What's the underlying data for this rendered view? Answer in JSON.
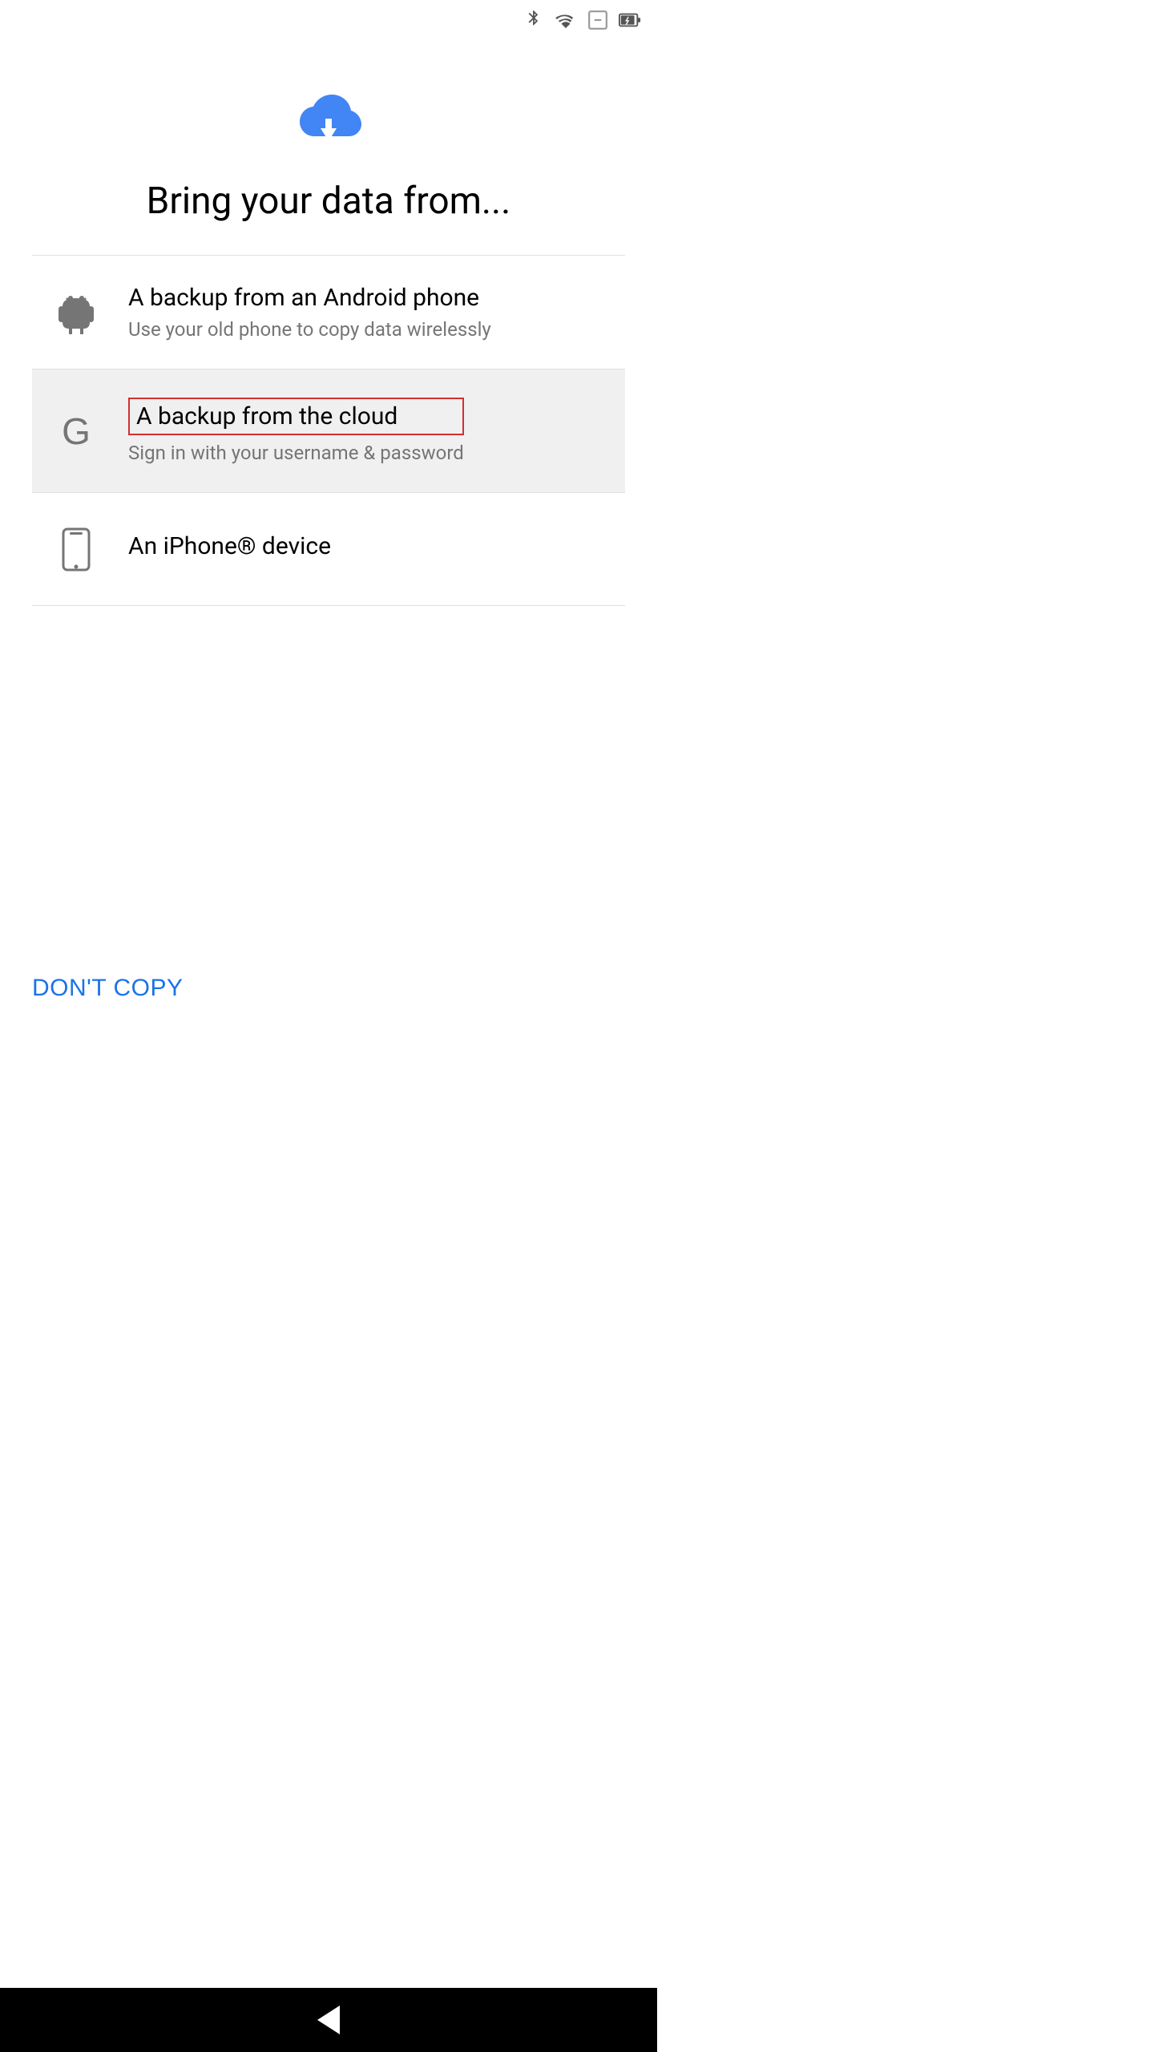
{
  "statusBar": {
    "icons": {
      "bluetooth": "bluetooth-icon",
      "wifi": "wifi-icon",
      "signal": "signal-icon",
      "battery": "battery-icon"
    }
  },
  "header": {
    "title": "Bring your data from..."
  },
  "listItems": [
    {
      "id": "android",
      "title": "A backup from an Android phone",
      "subtitle": "Use your old phone to copy data wirelessly",
      "highlighted": false
    },
    {
      "id": "cloud",
      "title": "A backup from the cloud",
      "subtitle": "Sign in with your username & password",
      "highlighted": true
    },
    {
      "id": "iphone",
      "title": "An iPhone® device",
      "subtitle": "",
      "highlighted": false
    }
  ],
  "footer": {
    "dontCopy": "DON'T COPY"
  }
}
